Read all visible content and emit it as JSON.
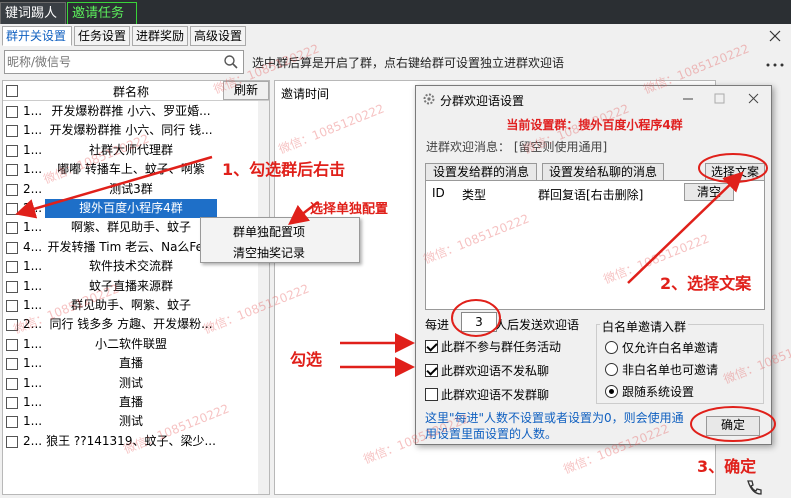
{
  "app_tabs": [
    "键词踢人",
    "邀请任务"
  ],
  "sub_tabs": [
    "群开关设置",
    "任务设置",
    "进群奖励",
    "高级设置"
  ],
  "search": {
    "placeholder": "昵称/微信号"
  },
  "hint": "选中群后算是开启了群，点右键给群可设置独立进群欢迎语",
  "group_list": {
    "header": "群名称",
    "refresh": "刷新",
    "rows": [
      {
        "num": "1...",
        "name": "开发爆粉群推 小六、罗亚婚...",
        "selected": false
      },
      {
        "num": "1...",
        "name": "开发爆粉群推 小六、同行 钱...",
        "selected": false
      },
      {
        "num": "1...",
        "name": "社群大师代理群",
        "selected": false
      },
      {
        "num": "1...",
        "name": "嘟嘟 转播车上、蚊子、啊紫",
        "selected": false
      },
      {
        "num": "2...",
        "name": "测试3群",
        "selected": false
      },
      {
        "num": "2...",
        "name": "搜外百度小程序4群",
        "selected": true
      },
      {
        "num": "1...",
        "name": "啊紫、群见助手、蚊子",
        "selected": false
      },
      {
        "num": "4...",
        "name": "开发转播 Tim 老云、Na么Fe...",
        "selected": false
      },
      {
        "num": "1...",
        "name": "软件技术交流群",
        "selected": false
      },
      {
        "num": "1...",
        "name": "蚊子直播来源群",
        "selected": false
      },
      {
        "num": "1...",
        "name": "群见助手、啊紫、蚊子",
        "selected": false
      },
      {
        "num": "2...",
        "name": "同行 钱多多 方趣、开发爆粉...",
        "selected": false
      },
      {
        "num": "1...",
        "name": "小二软件联盟",
        "selected": false
      },
      {
        "num": "1...",
        "name": "直播",
        "selected": false
      },
      {
        "num": "1...",
        "name": "测试",
        "selected": false
      },
      {
        "num": "1...",
        "name": "直播",
        "selected": false
      },
      {
        "num": "1...",
        "name": "测试",
        "selected": false
      },
      {
        "num": "2...",
        "name": "狼王 ??141319、蚊子、梁少...",
        "selected": false
      }
    ]
  },
  "right_pane": {
    "header": "邀请时间"
  },
  "context_menu": {
    "items": [
      "群单独配置项",
      "清空抽奖记录"
    ]
  },
  "dialog": {
    "title": "分群欢迎语设置",
    "current_group": "当前设置群：搜外百度小程序4群",
    "msg_label": "进群欢迎消息：  [留空则使用通用]",
    "btn_group_msg": "设置发给群的消息",
    "btn_private_msg": "设置发给私聊的消息",
    "btn_select": "选择文案",
    "col_id": "ID",
    "col_type": "类型",
    "col_content": "群回复语[右击删除]",
    "btn_clear": "清空",
    "every_prefix": "每进",
    "every_value": "3",
    "every_suffix": "人后发送欢迎语",
    "chk_no_task": "此群不参与群任务活动",
    "chk_no_private": "此群欢迎语不发私聊",
    "chk_no_group": "此群欢迎语不发群聊",
    "whitelist_title": "白名单邀请入群",
    "radio_only": "仅允许白名单邀请",
    "radio_non": "非白名单也可邀请",
    "radio_follow": "跟随系统设置",
    "note": "这里\"每进\"人数不设置或者设置为0，则会使用通用设置里面设置的人数。",
    "ok": "确定"
  },
  "annotations": {
    "step1": "1、勾选群后右击",
    "step1b": "选择单独配置",
    "step2": "2、选择文案",
    "check": "勾选",
    "step3": "3、确定"
  },
  "watermark": "微信：1085120222",
  "colors": {
    "accent": "#1e6fc8",
    "annotation": "#e0201a"
  }
}
